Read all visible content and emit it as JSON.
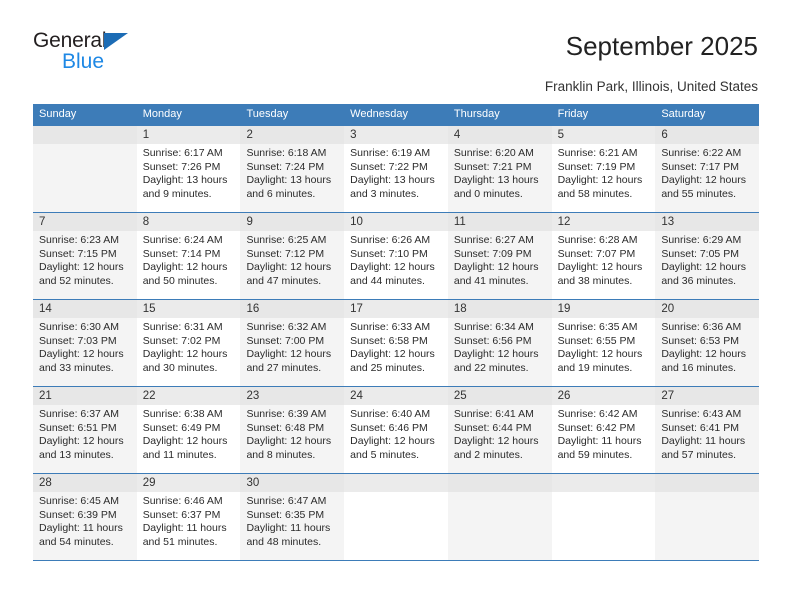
{
  "brand": {
    "name_top": "General",
    "name_bottom": "Blue",
    "triangle_color": "#1c6cb5",
    "blue_color": "#1e88e5"
  },
  "header": {
    "title": "September 2025",
    "subtitle": "Franklin Park, Illinois, United States"
  },
  "theme": {
    "header_blue": "#3d7cb8",
    "shaded_cell": "#f4f4f4",
    "daynum_band": "#ebebeb"
  },
  "calendar": {
    "weekdays": [
      "Sunday",
      "Monday",
      "Tuesday",
      "Wednesday",
      "Thursday",
      "Friday",
      "Saturday"
    ],
    "weeks": [
      [
        {
          "day": "",
          "sunrise": "",
          "sunset": "",
          "daylight": ""
        },
        {
          "day": "1",
          "sunrise": "Sunrise: 6:17 AM",
          "sunset": "Sunset: 7:26 PM",
          "daylight": "Daylight: 13 hours and 9 minutes."
        },
        {
          "day": "2",
          "sunrise": "Sunrise: 6:18 AM",
          "sunset": "Sunset: 7:24 PM",
          "daylight": "Daylight: 13 hours and 6 minutes."
        },
        {
          "day": "3",
          "sunrise": "Sunrise: 6:19 AM",
          "sunset": "Sunset: 7:22 PM",
          "daylight": "Daylight: 13 hours and 3 minutes."
        },
        {
          "day": "4",
          "sunrise": "Sunrise: 6:20 AM",
          "sunset": "Sunset: 7:21 PM",
          "daylight": "Daylight: 13 hours and 0 minutes."
        },
        {
          "day": "5",
          "sunrise": "Sunrise: 6:21 AM",
          "sunset": "Sunset: 7:19 PM",
          "daylight": "Daylight: 12 hours and 58 minutes."
        },
        {
          "day": "6",
          "sunrise": "Sunrise: 6:22 AM",
          "sunset": "Sunset: 7:17 PM",
          "daylight": "Daylight: 12 hours and 55 minutes."
        }
      ],
      [
        {
          "day": "7",
          "sunrise": "Sunrise: 6:23 AM",
          "sunset": "Sunset: 7:15 PM",
          "daylight": "Daylight: 12 hours and 52 minutes."
        },
        {
          "day": "8",
          "sunrise": "Sunrise: 6:24 AM",
          "sunset": "Sunset: 7:14 PM",
          "daylight": "Daylight: 12 hours and 50 minutes."
        },
        {
          "day": "9",
          "sunrise": "Sunrise: 6:25 AM",
          "sunset": "Sunset: 7:12 PM",
          "daylight": "Daylight: 12 hours and 47 minutes."
        },
        {
          "day": "10",
          "sunrise": "Sunrise: 6:26 AM",
          "sunset": "Sunset: 7:10 PM",
          "daylight": "Daylight: 12 hours and 44 minutes."
        },
        {
          "day": "11",
          "sunrise": "Sunrise: 6:27 AM",
          "sunset": "Sunset: 7:09 PM",
          "daylight": "Daylight: 12 hours and 41 minutes."
        },
        {
          "day": "12",
          "sunrise": "Sunrise: 6:28 AM",
          "sunset": "Sunset: 7:07 PM",
          "daylight": "Daylight: 12 hours and 38 minutes."
        },
        {
          "day": "13",
          "sunrise": "Sunrise: 6:29 AM",
          "sunset": "Sunset: 7:05 PM",
          "daylight": "Daylight: 12 hours and 36 minutes."
        }
      ],
      [
        {
          "day": "14",
          "sunrise": "Sunrise: 6:30 AM",
          "sunset": "Sunset: 7:03 PM",
          "daylight": "Daylight: 12 hours and 33 minutes."
        },
        {
          "day": "15",
          "sunrise": "Sunrise: 6:31 AM",
          "sunset": "Sunset: 7:02 PM",
          "daylight": "Daylight: 12 hours and 30 minutes."
        },
        {
          "day": "16",
          "sunrise": "Sunrise: 6:32 AM",
          "sunset": "Sunset: 7:00 PM",
          "daylight": "Daylight: 12 hours and 27 minutes."
        },
        {
          "day": "17",
          "sunrise": "Sunrise: 6:33 AM",
          "sunset": "Sunset: 6:58 PM",
          "daylight": "Daylight: 12 hours and 25 minutes."
        },
        {
          "day": "18",
          "sunrise": "Sunrise: 6:34 AM",
          "sunset": "Sunset: 6:56 PM",
          "daylight": "Daylight: 12 hours and 22 minutes."
        },
        {
          "day": "19",
          "sunrise": "Sunrise: 6:35 AM",
          "sunset": "Sunset: 6:55 PM",
          "daylight": "Daylight: 12 hours and 19 minutes."
        },
        {
          "day": "20",
          "sunrise": "Sunrise: 6:36 AM",
          "sunset": "Sunset: 6:53 PM",
          "daylight": "Daylight: 12 hours and 16 minutes."
        }
      ],
      [
        {
          "day": "21",
          "sunrise": "Sunrise: 6:37 AM",
          "sunset": "Sunset: 6:51 PM",
          "daylight": "Daylight: 12 hours and 13 minutes."
        },
        {
          "day": "22",
          "sunrise": "Sunrise: 6:38 AM",
          "sunset": "Sunset: 6:49 PM",
          "daylight": "Daylight: 12 hours and 11 minutes."
        },
        {
          "day": "23",
          "sunrise": "Sunrise: 6:39 AM",
          "sunset": "Sunset: 6:48 PM",
          "daylight": "Daylight: 12 hours and 8 minutes."
        },
        {
          "day": "24",
          "sunrise": "Sunrise: 6:40 AM",
          "sunset": "Sunset: 6:46 PM",
          "daylight": "Daylight: 12 hours and 5 minutes."
        },
        {
          "day": "25",
          "sunrise": "Sunrise: 6:41 AM",
          "sunset": "Sunset: 6:44 PM",
          "daylight": "Daylight: 12 hours and 2 minutes."
        },
        {
          "day": "26",
          "sunrise": "Sunrise: 6:42 AM",
          "sunset": "Sunset: 6:42 PM",
          "daylight": "Daylight: 11 hours and 59 minutes."
        },
        {
          "day": "27",
          "sunrise": "Sunrise: 6:43 AM",
          "sunset": "Sunset: 6:41 PM",
          "daylight": "Daylight: 11 hours and 57 minutes."
        }
      ],
      [
        {
          "day": "28",
          "sunrise": "Sunrise: 6:45 AM",
          "sunset": "Sunset: 6:39 PM",
          "daylight": "Daylight: 11 hours and 54 minutes."
        },
        {
          "day": "29",
          "sunrise": "Sunrise: 6:46 AM",
          "sunset": "Sunset: 6:37 PM",
          "daylight": "Daylight: 11 hours and 51 minutes."
        },
        {
          "day": "30",
          "sunrise": "Sunrise: 6:47 AM",
          "sunset": "Sunset: 6:35 PM",
          "daylight": "Daylight: 11 hours and 48 minutes."
        },
        {
          "day": "",
          "sunrise": "",
          "sunset": "",
          "daylight": ""
        },
        {
          "day": "",
          "sunrise": "",
          "sunset": "",
          "daylight": ""
        },
        {
          "day": "",
          "sunrise": "",
          "sunset": "",
          "daylight": ""
        },
        {
          "day": "",
          "sunrise": "",
          "sunset": "",
          "daylight": ""
        }
      ]
    ]
  }
}
